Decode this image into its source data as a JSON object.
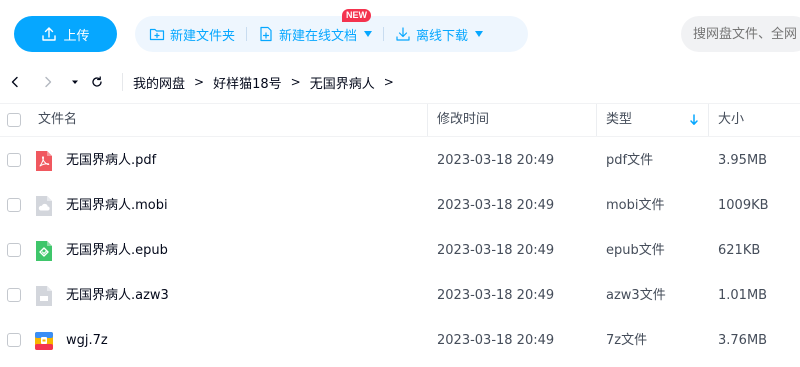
{
  "toolbar": {
    "upload_label": "上传",
    "new_folder_label": "新建文件夹",
    "new_online_doc_label": "新建在线文档",
    "new_badge": "NEW",
    "offline_download_label": "离线下载",
    "search_placeholder": "搜网盘文件、全网"
  },
  "breadcrumb": {
    "items": [
      "我的网盘",
      "好样猫18号",
      "无国界病人"
    ],
    "separator": ">"
  },
  "table": {
    "columns": {
      "name": "文件名",
      "modified": "修改时间",
      "type": "类型",
      "size": "大小"
    },
    "sort_column": "type",
    "rows": [
      {
        "name": "无国界病人.pdf",
        "modified": "2023-03-18 20:49",
        "type": "pdf文件",
        "size": "3.95MB",
        "icon": "pdf-file-icon"
      },
      {
        "name": "无国界病人.mobi",
        "modified": "2023-03-18 20:49",
        "type": "mobi文件",
        "size": "1009KB",
        "icon": "generic-file-icon"
      },
      {
        "name": "无国界病人.epub",
        "modified": "2023-03-18 20:49",
        "type": "epub文件",
        "size": "621KB",
        "icon": "epub-file-icon"
      },
      {
        "name": "无国界病人.azw3",
        "modified": "2023-03-18 20:49",
        "type": "azw3文件",
        "size": "1.01MB",
        "icon": "generic-file-icon"
      },
      {
        "name": "wgj.7z",
        "modified": "2023-03-18 20:49",
        "type": "7z文件",
        "size": "3.76MB",
        "icon": "archive-file-icon"
      }
    ]
  },
  "colors": {
    "accent": "#06a7ff",
    "accent_bg": "#eef6fe",
    "badge": "#f4334e",
    "pdf": "#f0585f",
    "epub": "#3fc66b",
    "generic": "#d3d6dc"
  }
}
